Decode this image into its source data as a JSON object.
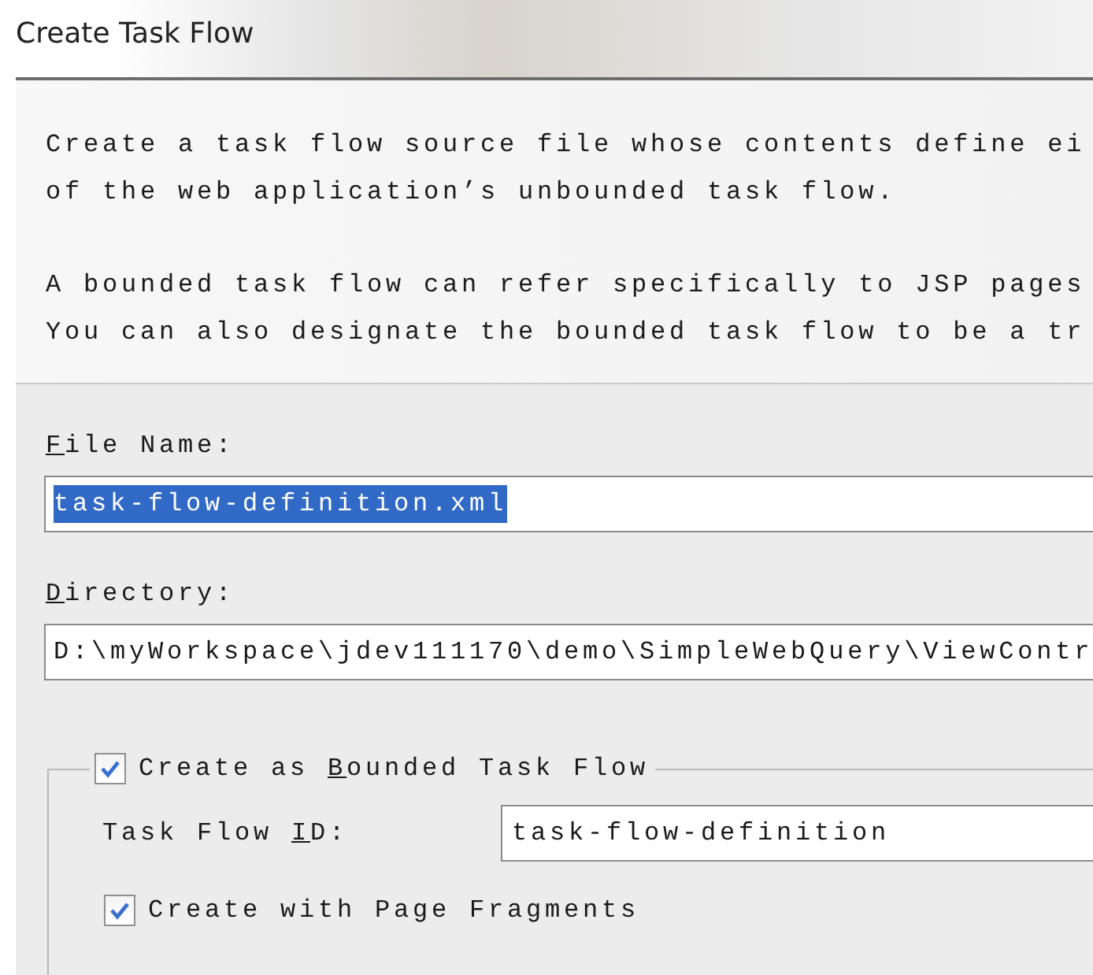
{
  "window": {
    "title": "Create Task Flow"
  },
  "description": [
    {
      "lines": [
        "Create a task flow source file whose contents define ei",
        "of the web application’s unbounded task flow."
      ]
    },
    {
      "lines": [
        "A bounded task flow can refer specifically to JSP pages",
        "You can also designate the bounded task flow to be a tr"
      ]
    }
  ],
  "fields": [
    {
      "mnemonic": "F",
      "label_end": "ile Name:",
      "value": "task-flow-definition.xml",
      "value_selected": true
    },
    {
      "mnemonic": "D",
      "label_end": "irectory:",
      "value": "D:\\myWorkspace\\jdev111170\\demo\\SimpleWebQuery\\ViewContr",
      "value_selected": false
    }
  ],
  "bounded_group": {
    "checkbox": {
      "label_start": "Create as ",
      "mnemonic": "B",
      "label_end": "ounded Task Flow",
      "checked": true
    },
    "task_flow_id": {
      "label_start": "Task Flow ",
      "mnemonic": "I",
      "label_end": "D:",
      "value": "task-flow-definition"
    },
    "page_fragments": {
      "label_start": "Create with Page Fragments",
      "checked": true
    }
  }
}
